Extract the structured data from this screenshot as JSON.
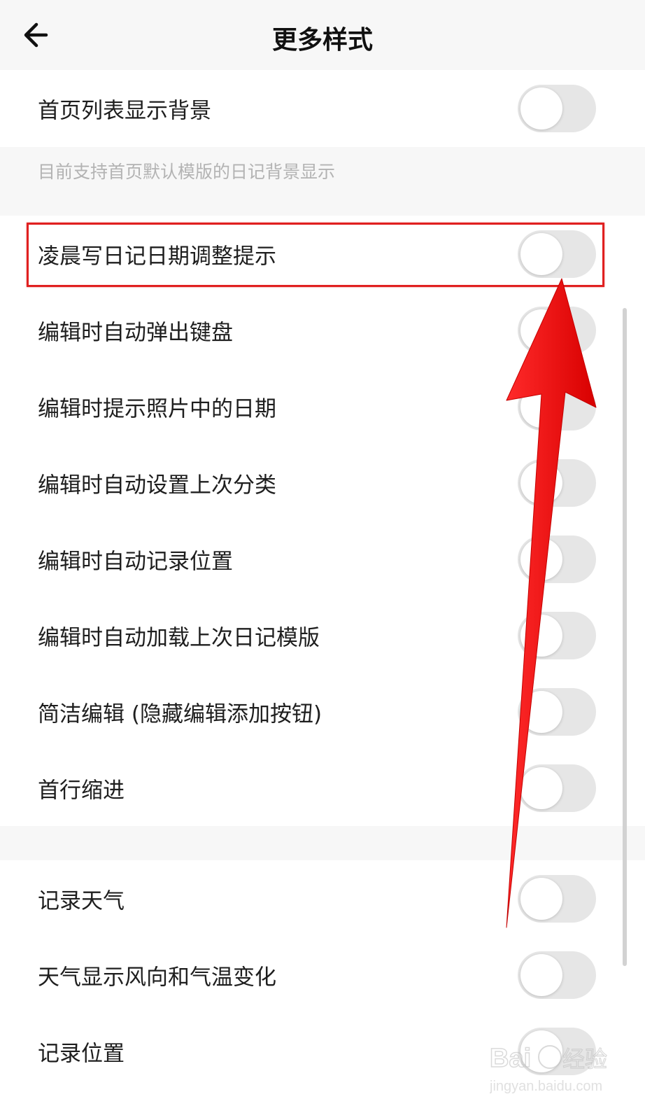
{
  "header": {
    "title": "更多样式",
    "back_icon": "arrow-left-icon"
  },
  "section1": {
    "items": [
      {
        "label": "首页列表显示背景",
        "enabled": false
      }
    ],
    "hint": "目前支持首页默认模版的日记背景显示"
  },
  "section2": {
    "items": [
      {
        "label": "凌晨写日记日期调整提示",
        "enabled": false
      },
      {
        "label": "编辑时自动弹出键盘",
        "enabled": false
      },
      {
        "label": "编辑时提示照片中的日期",
        "enabled": false
      },
      {
        "label": "编辑时自动设置上次分类",
        "enabled": false
      },
      {
        "label": "编辑时自动记录位置",
        "enabled": false
      },
      {
        "label": "编辑时自动加载上次日记模版",
        "enabled": false
      },
      {
        "label": "简洁编辑 (隐藏编辑添加按钮)",
        "enabled": false
      },
      {
        "label": "首行缩进",
        "enabled": false
      }
    ]
  },
  "section3": {
    "items": [
      {
        "label": "记录天气",
        "enabled": false
      },
      {
        "label": "天气显示风向和气温变化",
        "enabled": false
      },
      {
        "label": "记录位置",
        "enabled": false
      }
    ]
  },
  "annotation": {
    "highlight_color": "#e02020",
    "arrow_color": "#f01010"
  },
  "watermark": {
    "brand": "Baidu经验",
    "url": "jingyan.baidu.com"
  }
}
